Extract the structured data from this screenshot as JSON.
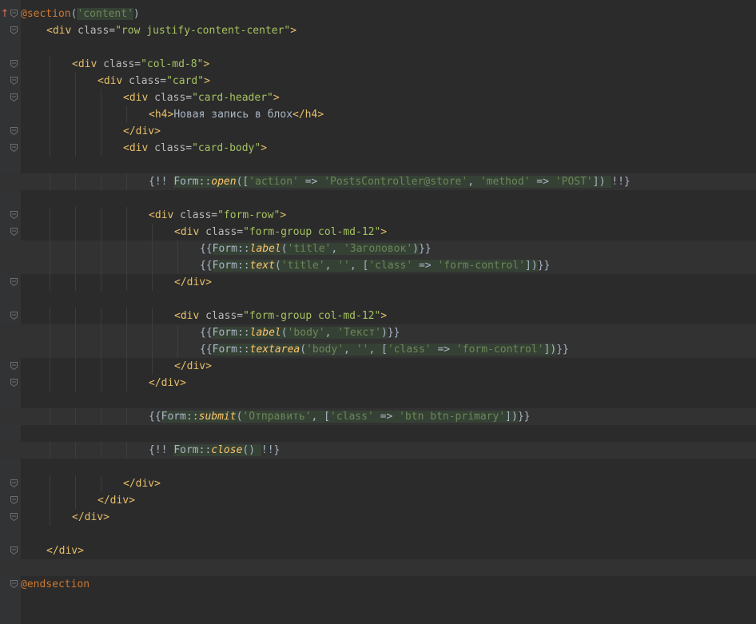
{
  "editor": {
    "colors": {
      "background": "#2b2b2b",
      "gutter": "#313335",
      "html_tag": "#e8bf6a",
      "html_attr": "#bababa",
      "html_value": "#a5c261",
      "php_string": "#6a8759",
      "php_keyword": "#cc7832",
      "php_method": "#ffc66d",
      "injected_bg": "#364135",
      "default_text": "#a9b7c6"
    },
    "lines": [
      {
        "marker": "↑",
        "fold": true,
        "indent": 0,
        "tokens": [
          {
            "c": "dir",
            "t": "@section"
          },
          {
            "c": "plain",
            "t": "("
          },
          {
            "c": "str inj",
            "t": "'content'"
          },
          {
            "c": "plain",
            "t": ")"
          }
        ]
      },
      {
        "fold": true,
        "indent": 1,
        "tokens": [
          {
            "c": "tag",
            "t": "<div "
          },
          {
            "c": "attr",
            "t": "class="
          },
          {
            "c": "val",
            "t": "\"row justify-content-center\""
          },
          {
            "c": "tag",
            "t": ">"
          }
        ]
      },
      {
        "indent": 0,
        "tokens": []
      },
      {
        "fold": true,
        "indent": 2,
        "tokens": [
          {
            "c": "tag",
            "t": "<div "
          },
          {
            "c": "attr",
            "t": "class="
          },
          {
            "c": "val",
            "t": "\"col-md-8\""
          },
          {
            "c": "tag",
            "t": ">"
          }
        ]
      },
      {
        "fold": true,
        "indent": 3,
        "tokens": [
          {
            "c": "tag",
            "t": "<div "
          },
          {
            "c": "attr",
            "t": "class="
          },
          {
            "c": "val",
            "t": "\"card\""
          },
          {
            "c": "tag",
            "t": ">"
          }
        ]
      },
      {
        "fold": true,
        "indent": 4,
        "tokens": [
          {
            "c": "tag",
            "t": "<div "
          },
          {
            "c": "attr",
            "t": "class="
          },
          {
            "c": "val",
            "t": "\"card-header\""
          },
          {
            "c": "tag",
            "t": ">"
          }
        ]
      },
      {
        "indent": 5,
        "tokens": [
          {
            "c": "tag",
            "t": "<h4>"
          },
          {
            "c": "plain",
            "t": "Новая запись в блох"
          },
          {
            "c": "tag",
            "t": "</h4>"
          }
        ]
      },
      {
        "fold": true,
        "indent": 4,
        "tokens": [
          {
            "c": "tag",
            "t": "</div>"
          }
        ]
      },
      {
        "fold": true,
        "indent": 4,
        "tokens": [
          {
            "c": "tag",
            "t": "<div "
          },
          {
            "c": "attr",
            "t": "class="
          },
          {
            "c": "val",
            "t": "\"card-body\""
          },
          {
            "c": "tag",
            "t": ">"
          }
        ]
      },
      {
        "indent": 0,
        "tokens": []
      },
      {
        "bg": true,
        "indent": 5,
        "tokens": [
          {
            "c": "blade",
            "t": "{!! "
          },
          {
            "c": "cls inj",
            "t": "Form::"
          },
          {
            "c": "fn inj",
            "t": "open"
          },
          {
            "c": "plain inj",
            "t": "(["
          },
          {
            "c": "str inj",
            "t": "'action'"
          },
          {
            "c": "plain inj",
            "t": " => "
          },
          {
            "c": "str inj",
            "t": "'PostsController@store'"
          },
          {
            "c": "plain inj",
            "t": ", "
          },
          {
            "c": "str inj",
            "t": "'method'"
          },
          {
            "c": "plain inj",
            "t": " => "
          },
          {
            "c": "str inj",
            "t": "'POST'"
          },
          {
            "c": "plain inj",
            "t": "]) "
          },
          {
            "c": "blade",
            "t": "!!}"
          }
        ]
      },
      {
        "indent": 0,
        "tokens": []
      },
      {
        "fold": true,
        "indent": 5,
        "tokens": [
          {
            "c": "tag",
            "t": "<div "
          },
          {
            "c": "attr",
            "t": "class="
          },
          {
            "c": "val",
            "t": "\"form-row\""
          },
          {
            "c": "tag",
            "t": ">"
          }
        ]
      },
      {
        "fold": true,
        "indent": 6,
        "tokens": [
          {
            "c": "tag",
            "t": "<div "
          },
          {
            "c": "attr",
            "t": "class="
          },
          {
            "c": "val",
            "t": "\"form-group col-md-12\""
          },
          {
            "c": "tag",
            "t": ">"
          }
        ]
      },
      {
        "bg": true,
        "indent": 7,
        "tokens": [
          {
            "c": "blade",
            "t": "{{"
          },
          {
            "c": "cls inj",
            "t": "Form::"
          },
          {
            "c": "fn inj",
            "t": "label"
          },
          {
            "c": "plain inj",
            "t": "("
          },
          {
            "c": "str inj",
            "t": "'title'"
          },
          {
            "c": "plain inj",
            "t": ", "
          },
          {
            "c": "str inj",
            "t": "'Заголовок'"
          },
          {
            "c": "plain inj",
            "t": ")"
          },
          {
            "c": "blade",
            "t": "}}"
          }
        ]
      },
      {
        "bg": true,
        "indent": 7,
        "tokens": [
          {
            "c": "blade",
            "t": "{{"
          },
          {
            "c": "cls inj",
            "t": "Form::"
          },
          {
            "c": "fn inj",
            "t": "text"
          },
          {
            "c": "plain inj",
            "t": "("
          },
          {
            "c": "str inj",
            "t": "'title'"
          },
          {
            "c": "plain inj",
            "t": ", "
          },
          {
            "c": "str inj",
            "t": "''"
          },
          {
            "c": "plain inj",
            "t": ", ["
          },
          {
            "c": "str inj",
            "t": "'class'"
          },
          {
            "c": "plain inj",
            "t": " => "
          },
          {
            "c": "str inj",
            "t": "'form-control'"
          },
          {
            "c": "plain inj",
            "t": "])"
          },
          {
            "c": "blade",
            "t": "}}"
          }
        ]
      },
      {
        "fold": true,
        "indent": 6,
        "tokens": [
          {
            "c": "tag",
            "t": "</div>"
          }
        ]
      },
      {
        "indent": 0,
        "tokens": []
      },
      {
        "fold": true,
        "indent": 6,
        "tokens": [
          {
            "c": "tag",
            "t": "<div "
          },
          {
            "c": "attr",
            "t": "class="
          },
          {
            "c": "val",
            "t": "\"form-group col-md-12\""
          },
          {
            "c": "tag",
            "t": ">"
          }
        ]
      },
      {
        "bg": true,
        "indent": 7,
        "tokens": [
          {
            "c": "blade",
            "t": "{{"
          },
          {
            "c": "cls inj",
            "t": "Form::"
          },
          {
            "c": "fn inj",
            "t": "label"
          },
          {
            "c": "plain inj",
            "t": "("
          },
          {
            "c": "str inj",
            "t": "'body'"
          },
          {
            "c": "plain inj",
            "t": ", "
          },
          {
            "c": "str inj",
            "t": "'Текст'"
          },
          {
            "c": "plain inj",
            "t": ")"
          },
          {
            "c": "blade",
            "t": "}}"
          }
        ]
      },
      {
        "bg": true,
        "indent": 7,
        "tokens": [
          {
            "c": "blade",
            "t": "{{"
          },
          {
            "c": "cls inj",
            "t": "Form::"
          },
          {
            "c": "fn inj",
            "t": "textarea"
          },
          {
            "c": "plain inj",
            "t": "("
          },
          {
            "c": "str inj",
            "t": "'body'"
          },
          {
            "c": "plain inj",
            "t": ", "
          },
          {
            "c": "str inj",
            "t": "''"
          },
          {
            "c": "plain inj",
            "t": ", ["
          },
          {
            "c": "str inj",
            "t": "'class'"
          },
          {
            "c": "plain inj",
            "t": " => "
          },
          {
            "c": "str inj",
            "t": "'form-control'"
          },
          {
            "c": "plain inj",
            "t": "])"
          },
          {
            "c": "blade",
            "t": "}}"
          }
        ]
      },
      {
        "fold": true,
        "indent": 6,
        "tokens": [
          {
            "c": "tag",
            "t": "</div>"
          }
        ]
      },
      {
        "fold": true,
        "indent": 5,
        "tokens": [
          {
            "c": "tag",
            "t": "</div>"
          }
        ]
      },
      {
        "indent": 0,
        "tokens": []
      },
      {
        "bg": true,
        "indent": 5,
        "tokens": [
          {
            "c": "blade",
            "t": "{{"
          },
          {
            "c": "cls inj",
            "t": "Form::"
          },
          {
            "c": "fn inj",
            "t": "submit"
          },
          {
            "c": "plain inj",
            "t": "("
          },
          {
            "c": "str inj",
            "t": "'Отправить'"
          },
          {
            "c": "plain inj",
            "t": ", ["
          },
          {
            "c": "str inj",
            "t": "'class'"
          },
          {
            "c": "plain inj",
            "t": " => "
          },
          {
            "c": "str inj",
            "t": "'btn btn-primary'"
          },
          {
            "c": "plain inj",
            "t": "])"
          },
          {
            "c": "blade",
            "t": "}}"
          }
        ]
      },
      {
        "indent": 0,
        "tokens": []
      },
      {
        "bg": true,
        "indent": 5,
        "tokens": [
          {
            "c": "blade",
            "t": "{!! "
          },
          {
            "c": "cls inj",
            "t": "Form::"
          },
          {
            "c": "fn inj",
            "t": "close"
          },
          {
            "c": "plain inj",
            "t": "() "
          },
          {
            "c": "blade",
            "t": "!!}"
          }
        ]
      },
      {
        "indent": 0,
        "tokens": []
      },
      {
        "fold": true,
        "indent": 4,
        "tokens": [
          {
            "c": "tag",
            "t": "</div>"
          }
        ]
      },
      {
        "fold": true,
        "indent": 3,
        "tokens": [
          {
            "c": "tag",
            "t": "</div>"
          }
        ]
      },
      {
        "fold": true,
        "indent": 2,
        "tokens": [
          {
            "c": "tag",
            "t": "</div>"
          }
        ]
      },
      {
        "indent": 0,
        "tokens": []
      },
      {
        "fold": true,
        "indent": 1,
        "tokens": [
          {
            "c": "tag",
            "t": "</div>"
          }
        ]
      },
      {
        "bg": true,
        "indent": 0,
        "tokens": []
      },
      {
        "fold": true,
        "indent": 0,
        "tokens": [
          {
            "c": "dir",
            "t": "@endsection"
          }
        ]
      },
      {
        "indent": 0,
        "tokens": []
      }
    ]
  }
}
